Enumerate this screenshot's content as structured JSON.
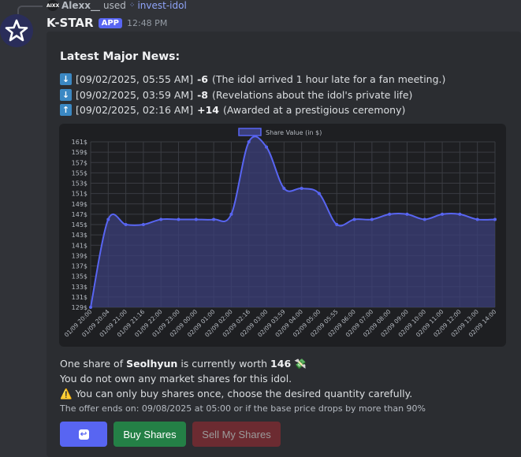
{
  "reply": {
    "user": "Alexx__",
    "verb": "used",
    "command": "invest-idol",
    "avatar_text": "AIXX"
  },
  "bot": {
    "name": "K-STAR",
    "badge": "APP",
    "time": "12:48 PM"
  },
  "embed": {
    "title": "Latest Major News:",
    "news": [
      {
        "direction": "down",
        "date": "[09/02/2025, 05:55 AM]",
        "delta": "-6",
        "text": "(The idol arrived 1 hour late for a fan meeting.)"
      },
      {
        "direction": "down",
        "date": "[09/02/2025, 03:59 AM]",
        "delta": "-8",
        "text": "(Revelations about the idol's private life)"
      },
      {
        "direction": "up",
        "date": "[09/02/2025, 02:16 AM]",
        "delta": "+14",
        "text": "(Awarded at a prestigious ceremony)"
      }
    ],
    "info": {
      "worth_prefix": "One share of",
      "idol": "Seolhyun",
      "worth_mid": "is currently worth",
      "worth_value": "146",
      "worth_emoji": "💸",
      "own_line": "You do not own any market shares for this idol.",
      "warning_emoji": "⚠️",
      "warning_line": "You can only buy shares once, choose the desired quantity carefully.",
      "footer": "The offer ends on: 09/08/2025 at 05:00 or if the base price drops by more than 90%"
    },
    "buttons": {
      "refresh_icon": "↩",
      "buy": "Buy Shares",
      "sell": "Sell My Shares"
    }
  },
  "colors": {
    "line": "#5865f2",
    "fill": "#3b3f7a",
    "buy": "#248046",
    "sell": "#6c2b31",
    "accent": "#5865f2"
  },
  "chart_data": {
    "type": "area",
    "legend": "Share Value (in $)",
    "legend_position": "top-center",
    "grid": true,
    "ylim": [
      129,
      161
    ],
    "yticks": [
      "129$",
      "131$",
      "133$",
      "135$",
      "137$",
      "139$",
      "141$",
      "143$",
      "145$",
      "147$",
      "149$",
      "151$",
      "153$",
      "155$",
      "157$",
      "159$",
      "161$"
    ],
    "x": [
      "01/09 20:00",
      "01/09 20:04",
      "01/09 21:00",
      "01/09 21:16",
      "01/09 22:00",
      "01/09 23:00",
      "02/09 00:00",
      "02/09 01:00",
      "02/09 02:00",
      "02/09 02:16",
      "02/09 03:00",
      "02/09 03:59",
      "02/09 04:00",
      "02/09 05:00",
      "02/09 05:55",
      "02/09 06:00",
      "02/09 07:00",
      "02/09 08:00",
      "02/09 09:00",
      "02/09 10:00",
      "02/09 11:00",
      "02/09 12:00",
      "02/09 13:00",
      "02/09 14:00"
    ],
    "series": [
      {
        "name": "Share Value (in $)",
        "values": [
          129,
          146,
          145,
          145,
          146,
          146,
          146,
          146,
          147,
          161,
          160,
          152,
          152,
          151,
          145,
          146,
          146,
          147,
          147,
          146,
          147,
          147,
          146,
          146
        ]
      }
    ]
  }
}
